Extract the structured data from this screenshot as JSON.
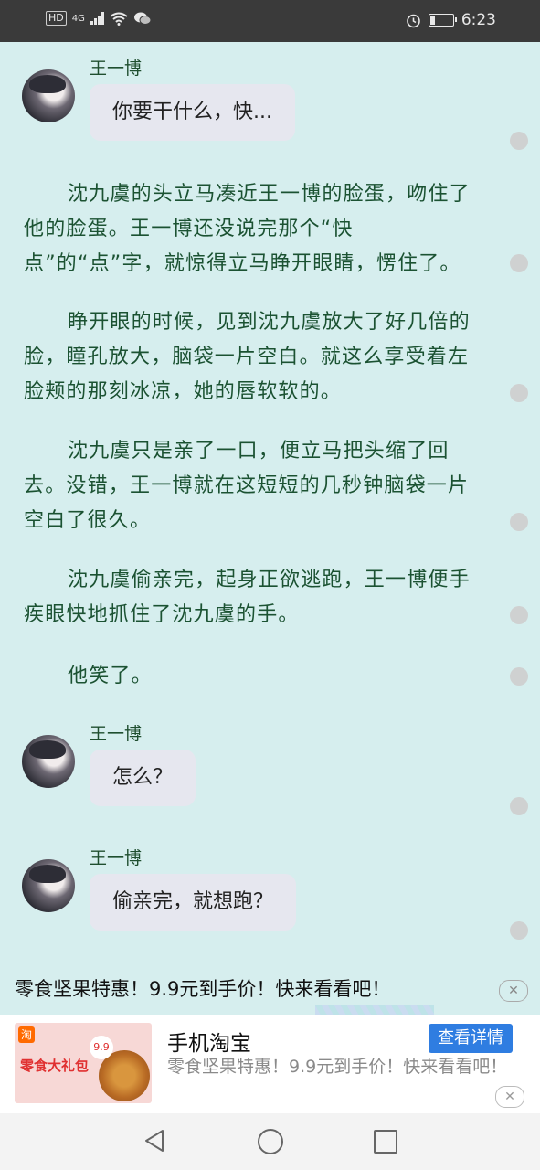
{
  "status_bar": {
    "badges": [
      "HD",
      "4G"
    ],
    "time": "6:23"
  },
  "chat": [
    {
      "sender": "王一博",
      "text": "你要干什么，快..."
    },
    {
      "sender": "王一博",
      "text": "怎么？"
    },
    {
      "sender": "王一博",
      "text": "偷亲完，就想跑？"
    }
  ],
  "narrative": [
    "沈九虞的头立马凑近王一博的脸蛋，吻住了他的脸蛋。王一博还没说完那个“快点”的“点”字，就惊得立马睁开眼睛，愣住了。",
    "睁开眼的时候，见到沈九虞放大了好几倍的脸，瞳孔放大，脑袋一片空白。就这么享受着左脸颊的那刻冰凉，她的唇软软的。",
    "沈九虞只是亲了一口，便立马把头缩了回去。没错，王一博就在这短短的几秒钟脑袋一片空白了很久。",
    "沈九虞偷亲完，起身正欲逃跑，王一博便手疾眼快地抓住了沈九虞的手。",
    "他笑了。"
  ],
  "ad": {
    "headline": "零食坚果特惠！9.9元到手价！快来看看吧！",
    "app_name": "手机淘宝",
    "description": "零食坚果特惠！9.9元到手价！快来看看吧！",
    "button_label": "查看详情",
    "image_text": "零食大礼包",
    "image_tag": "淘",
    "image_price": "9.9",
    "close_glyph": "✕"
  },
  "colors": {
    "background": "#d6eeee",
    "narrative_text": "#1b5232",
    "bubble": "#e6e7ef",
    "ad_button": "#2f7de1"
  }
}
